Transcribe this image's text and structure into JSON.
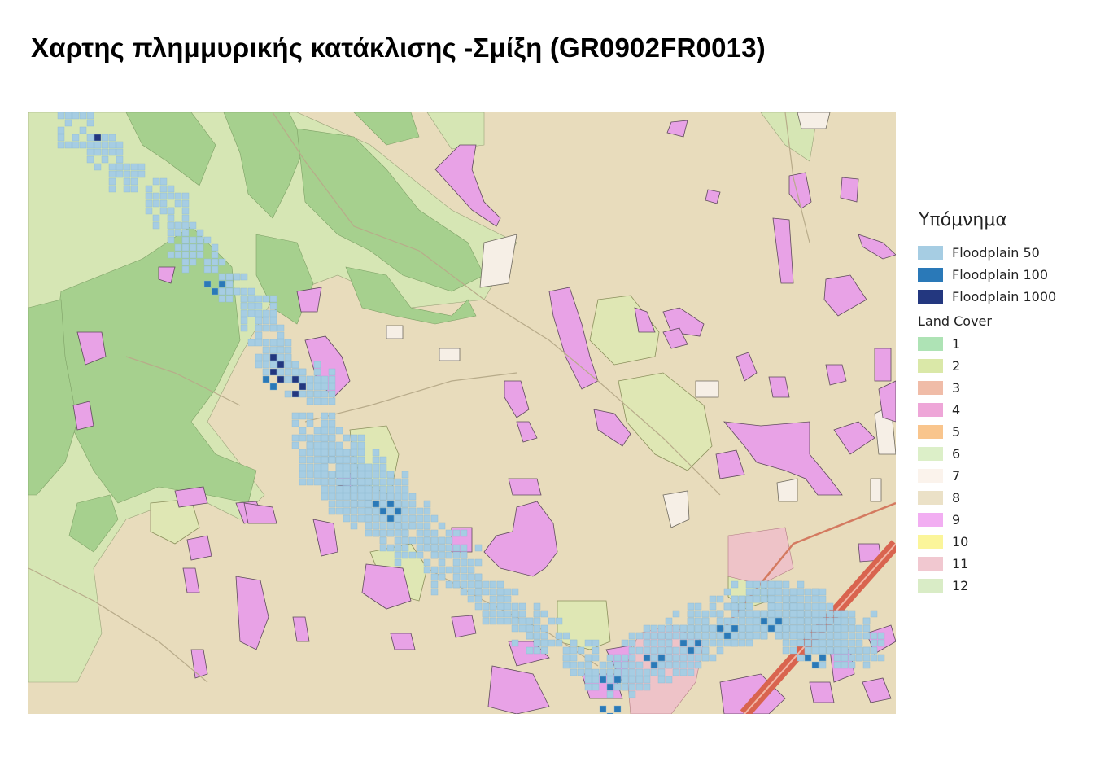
{
  "title": "Χαρτης πλημμυρικής κατάκλισης -Σμίξη (GR0902FR0013)",
  "map": {
    "colors": {
      "background": "#e8dcbc",
      "forest": "#a6d08e",
      "grassland": "#d6e6b4",
      "urban": "#dfe7b4",
      "agri_patch": "#e8a2e6",
      "bare": "#f6efe6",
      "road_highway": "#d9644f",
      "floodplain50": "#a6cde3",
      "floodplain100": "#2a79b8",
      "floodplain1000": "#23377f"
    }
  },
  "legend": {
    "title": "Υπόμνημα",
    "flood_items": [
      {
        "label": "Floodplain 50",
        "color": "#a6cde3"
      },
      {
        "label": "Floodplain 100",
        "color": "#2a79b8"
      },
      {
        "label": "Floodplain 1000",
        "color": "#23377f"
      }
    ],
    "landcover_title": "Land Cover",
    "landcover_items": [
      {
        "label": "1",
        "color": "#aee3b5"
      },
      {
        "label": "2",
        "color": "#dae8a8"
      },
      {
        "label": "3",
        "color": "#f0bca8"
      },
      {
        "label": "4",
        "color": "#eea6d8"
      },
      {
        "label": "5",
        "color": "#f9c58d"
      },
      {
        "label": "6",
        "color": "#dcefc8"
      },
      {
        "label": "7",
        "color": "#fbf3ec"
      },
      {
        "label": "8",
        "color": "#ebe1c7"
      },
      {
        "label": "9",
        "color": "#f2aef2"
      },
      {
        "label": "10",
        "color": "#fbf59a"
      },
      {
        "label": "11",
        "color": "#f1c8d0"
      },
      {
        "label": "12",
        "color": "#d9ecc6"
      }
    ]
  }
}
